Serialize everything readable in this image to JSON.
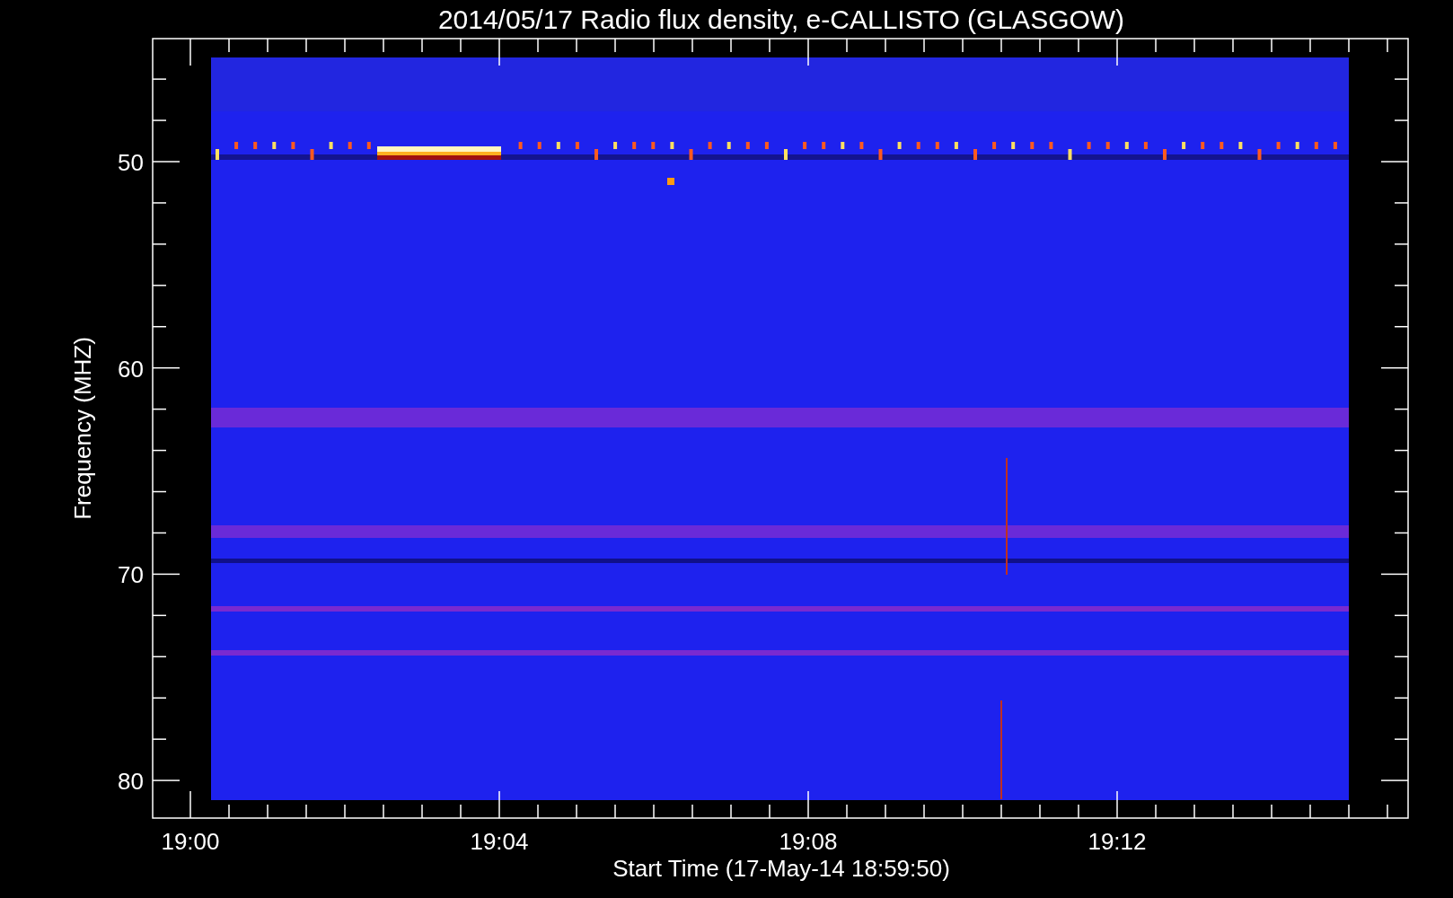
{
  "title": "2014/05/17  Radio flux density, e-CALLISTO (GLASGOW)",
  "y_axis": {
    "label": "Frequency (MHZ)",
    "ticks": [
      "50",
      "60",
      "70",
      "80"
    ]
  },
  "x_axis": {
    "label": "Start Time (17-May-14 18:59:50)",
    "ticks": [
      "19:00",
      "19:04",
      "19:08",
      "19:12"
    ]
  }
}
